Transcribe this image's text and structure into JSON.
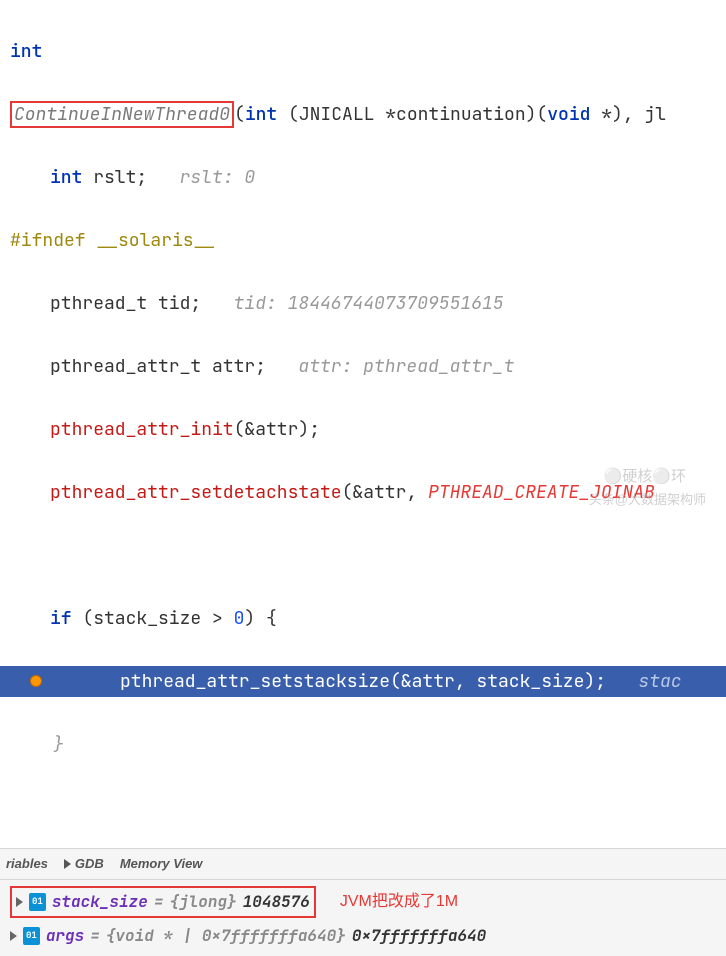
{
  "code": {
    "l1_kw": "int",
    "l2_fn": "ContinueInNewThread0",
    "l2_sig_a": "(",
    "l2_sig_b": "int",
    "l2_sig_c": " (JNICALL *continuation)(",
    "l2_sig_d": "void",
    "l2_sig_e": " *), jl",
    "l3_a": "int",
    "l3_b": " rslt;",
    "l3_hint": "   rslt: 0",
    "l4_a": "#ifndef",
    "l4_b": " __solaris__",
    "l5_a": "pthread_t tid;",
    "l5_hint": "   tid: 18446744073709551615",
    "l6_a": "pthread_attr_t attr;",
    "l6_hint": "   attr: pthread_attr_t",
    "l7_fn": "pthread_attr_init",
    "l7_args": "(&attr);",
    "l8_fn": "pthread_attr_setdetachstate",
    "l8_args": "(&attr, ",
    "l8_macro": "PTHREAD_CREATE_JOINAB",
    "l10_a": "if",
    "l10_b": " (stack_size > ",
    "l10_num": "0",
    "l10_c": ") {",
    "l11_fn": "pthread_attr_setstacksize(&attr, stack_size);",
    "l11_hint": "   stac",
    "l12": "    }"
  },
  "tabs": {
    "variables": "riables",
    "gdb": "GDB",
    "memview": "Memory View"
  },
  "vars": {
    "row1": {
      "badge": "01",
      "name": "stack_size",
      "eq": " = ",
      "type": "{jlong}",
      "value": " 1048576",
      "annot": "JVM把改成了1M"
    },
    "row2": {
      "badge": "01",
      "name": "args",
      "eq": " = ",
      "type": "{void * | 0x7fffffffa640}",
      "value": " 0x7fffffffa640"
    }
  },
  "watermark": {
    "w1": "⚪硬核⚪环",
    "w2": "头条@大数据架构师"
  }
}
